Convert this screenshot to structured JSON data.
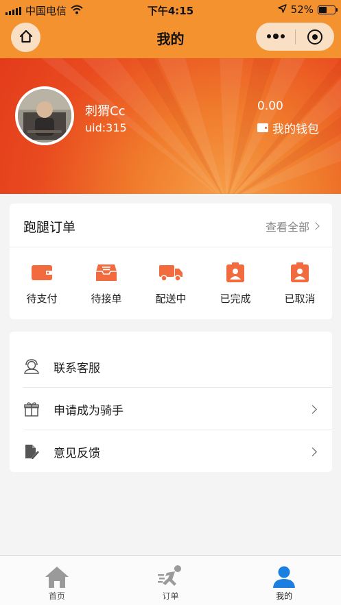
{
  "status_bar": {
    "carrier": "中国电信",
    "time": "下午4:15",
    "battery": "52%",
    "battery_level": 0.52
  },
  "nav": {
    "title": "我的"
  },
  "profile": {
    "username": "刺猬Cc",
    "uid": "uid:315",
    "balance": "0.00",
    "wallet_label": "我的钱包"
  },
  "orders": {
    "title": "跑腿订单",
    "view_all": "查看全部",
    "items": [
      {
        "label": "待支付",
        "icon": "wallet-icon"
      },
      {
        "label": "待接单",
        "icon": "inbox-icon"
      },
      {
        "label": "配送中",
        "icon": "delivery-truck-icon"
      },
      {
        "label": "已完成",
        "icon": "badge-person-icon"
      },
      {
        "label": "已取消",
        "icon": "badge-person-icon"
      }
    ]
  },
  "menu": {
    "items": [
      {
        "label": "联系客服",
        "icon": "customer-service-icon"
      },
      {
        "label": "申请成为骑手",
        "icon": "gift-icon"
      },
      {
        "label": "意见反馈",
        "icon": "edit-document-icon"
      }
    ]
  },
  "tabbar": {
    "items": [
      {
        "label": "首页",
        "icon": "home-icon",
        "active": false
      },
      {
        "label": "订单",
        "icon": "runner-icon",
        "active": false
      },
      {
        "label": "我的",
        "icon": "user-icon",
        "active": true
      }
    ]
  },
  "colors": {
    "accent_orange": "#f4922f",
    "icon_orange": "#f26b3f",
    "active_blue": "#1a7fe0",
    "tab_gray": "#9a9a9a"
  }
}
